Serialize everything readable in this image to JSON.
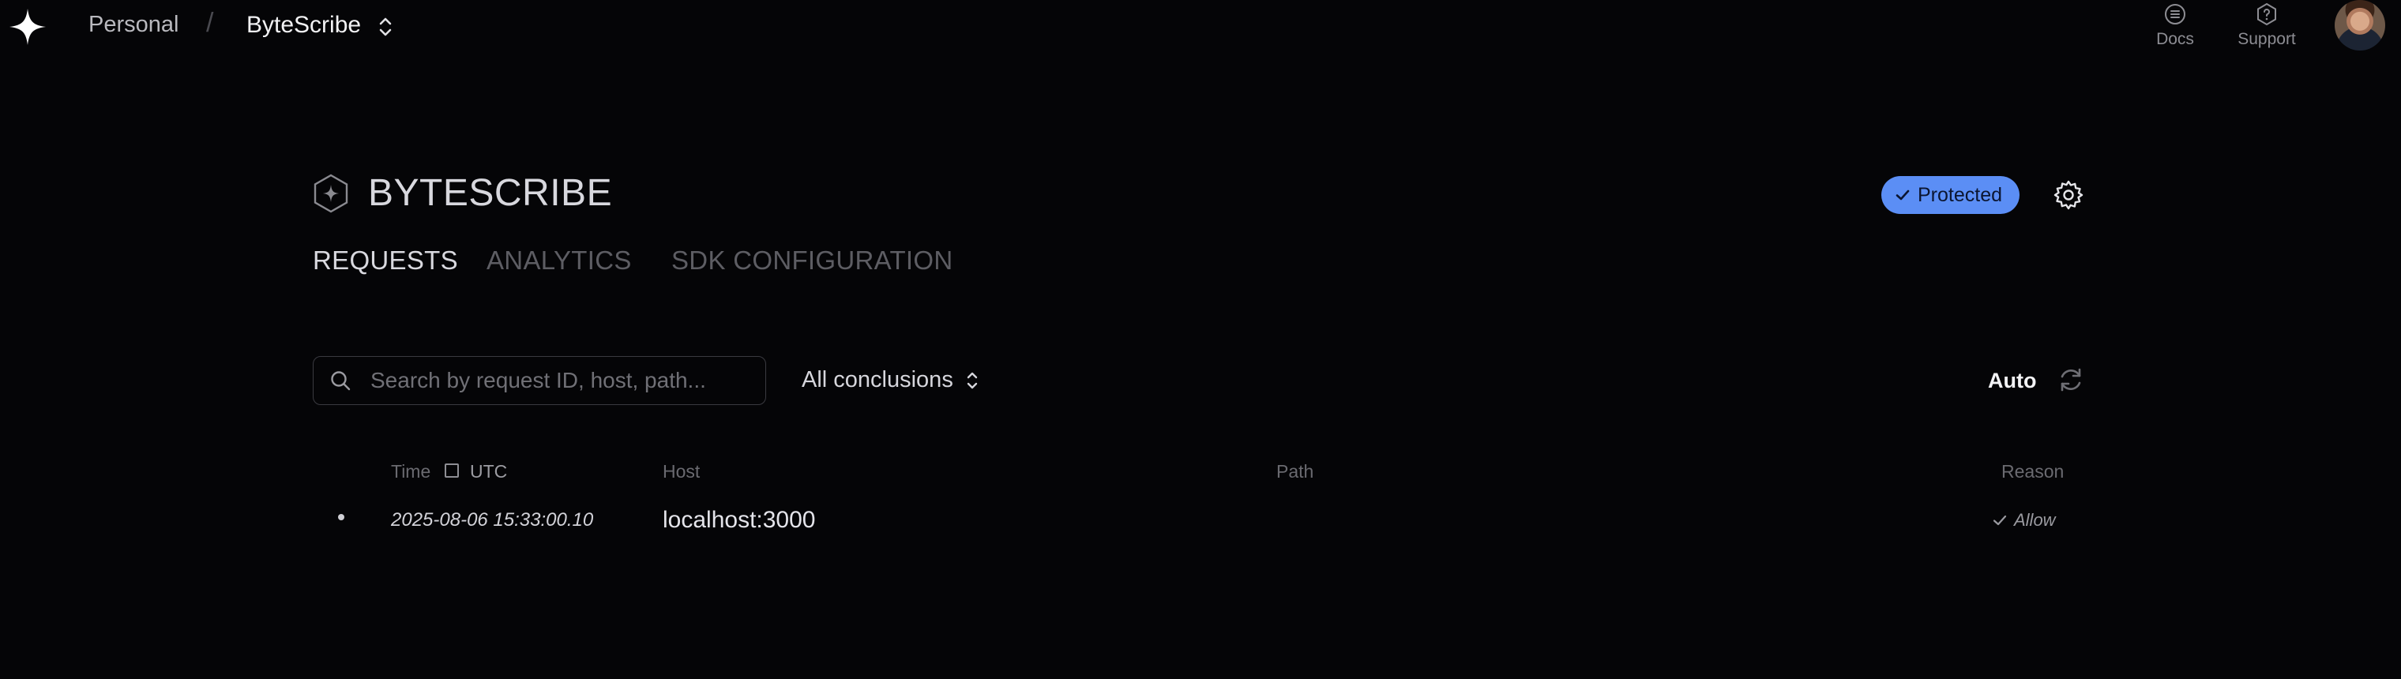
{
  "nav": {
    "workspace": "Personal",
    "separator": "/",
    "project": "ByteScribe",
    "docs_label": "Docs",
    "support_label": "Support"
  },
  "header": {
    "title": "BYTESCRIBE",
    "status_badge": "Protected"
  },
  "tabs": [
    {
      "label": "REQUESTS",
      "active": true
    },
    {
      "label": "ANALYTICS",
      "active": false
    },
    {
      "label": "SDK CONFIGURATION",
      "active": false
    }
  ],
  "filters": {
    "search_placeholder": "Search by request ID, host, path...",
    "conclusion_select": "All conclusions",
    "refresh_mode": "Auto"
  },
  "table": {
    "columns": {
      "time": "Time",
      "utc": "UTC",
      "host": "Host",
      "path": "Path",
      "reason": "Reason"
    },
    "utc_checked": false,
    "rows": [
      {
        "time": "2025-08-06 15:33:00.10",
        "host": "localhost:3000",
        "path": "",
        "reason": "Allow"
      }
    ]
  },
  "colors": {
    "background": "#050507",
    "accent": "#5b8ef5"
  }
}
